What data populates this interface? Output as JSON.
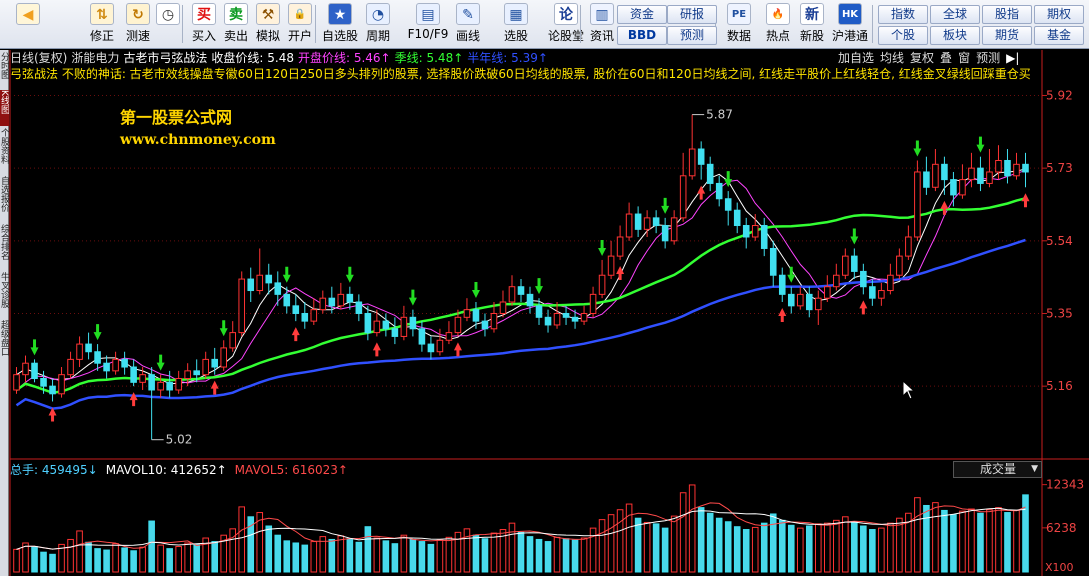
{
  "toolbar": {
    "left_buttons": [
      {
        "name": "back",
        "label": "",
        "icon": "back-arrow-icon"
      },
      {
        "name": "modify",
        "label": "修正",
        "icon": "up-down-icon"
      },
      {
        "name": "measure",
        "label": "测速",
        "icon": "refresh-icon"
      },
      {
        "name": "clock",
        "label": "",
        "icon": "clock-icon"
      },
      {
        "name": "buy",
        "label": "买入",
        "icon": "buy-icon"
      },
      {
        "name": "sell",
        "label": "卖出",
        "icon": "sell-icon"
      },
      {
        "name": "simulate",
        "label": "模拟",
        "icon": "hammer-icon"
      },
      {
        "name": "open-account",
        "label": "开户",
        "icon": "lock-icon"
      },
      {
        "name": "custom-stock",
        "label": "自选股",
        "icon": "star-icon"
      },
      {
        "name": "period",
        "label": "周期",
        "icon": "period-icon"
      },
      {
        "name": "f10",
        "label": "F10/F9",
        "icon": "f10-icon"
      },
      {
        "name": "draw",
        "label": "画线",
        "icon": "pencil-icon"
      },
      {
        "name": "select",
        "label": "选股",
        "icon": "select-icon"
      },
      {
        "name": "forum",
        "label": "论股堂",
        "icon": "forum-icon"
      },
      {
        "name": "info",
        "label": "资讯",
        "icon": "news-icon"
      },
      {
        "name": "data",
        "label": "数据",
        "icon": "pe-icon"
      },
      {
        "name": "hot",
        "label": "热点",
        "icon": "flame-icon"
      },
      {
        "name": "new-stock",
        "label": "新股",
        "icon": "newstock-icon"
      },
      {
        "name": "hk-connect",
        "label": "沪港通",
        "icon": "hk-icon"
      }
    ],
    "mid_buttons": [
      {
        "label": "资金"
      },
      {
        "label": "研报"
      },
      {
        "label": "BBD"
      },
      {
        "label": "预测"
      }
    ],
    "right_buttons": [
      {
        "label": "指数"
      },
      {
        "label": "全球"
      },
      {
        "label": "股指"
      },
      {
        "label": "期权"
      },
      {
        "label": "个股"
      },
      {
        "label": "板块"
      },
      {
        "label": "期货"
      },
      {
        "label": "基金"
      }
    ]
  },
  "sidebar": {
    "tabs": [
      {
        "label": "分时图",
        "active": false
      },
      {
        "label": "K线图",
        "active": true
      },
      {
        "label": "个股资料",
        "active": false
      },
      {
        "label": "自选报价",
        "active": false
      },
      {
        "label": "综合排名",
        "active": false
      },
      {
        "label": "牛叉诊股",
        "active": false
      },
      {
        "label": "超级盘口",
        "active": false
      }
    ]
  },
  "chart_header": {
    "items": [
      {
        "text": "日线(复权)",
        "color": "#dcdcdc"
      },
      {
        "text": "浙能电力",
        "color": "#dcdcdc"
      },
      {
        "text": "古老市弓弦战法",
        "color": "#ffffff"
      },
      {
        "text": "收盘价线: 5.48",
        "color": "#ffffff"
      },
      {
        "text": "开盘价线: 5.46↑",
        "color": "#ff44ff"
      },
      {
        "text": "季线: 5.48↑",
        "color": "#33ff33"
      },
      {
        "text": "半年线: 5.39↑",
        "color": "#3050ff"
      }
    ],
    "controls": [
      "加自选",
      "均线",
      "复权",
      "叠",
      "窗",
      "预测"
    ]
  },
  "description": "弓弦战法  不败的神话: 古老市效线操盘专徽60日120日250日多头排列的股票, 选择股价跌破60日均线的股票, 股价在60日和120日均线之间, 红线走平股价上红线轻仓, 红线金叉绿线回踩重仓买",
  "watermark": {
    "line1": "第一股票公式网",
    "line2": "www.chnmoney.com"
  },
  "chart_data": {
    "type": "candlestick",
    "price_axis_ticks": [
      5.92,
      5.73,
      5.54,
      5.35,
      5.16
    ],
    "price_range": [
      4.98,
      5.95
    ],
    "high_label": "5.87",
    "low_label": "5.02",
    "volume_axis_ticks": [
      12343,
      6238
    ],
    "volume_unit": "X100",
    "candles": [
      [
        5.15,
        5.19,
        5.14,
        5.21
      ],
      [
        5.19,
        5.22,
        5.17,
        5.24
      ],
      [
        5.22,
        5.18,
        5.17,
        5.23
      ],
      [
        5.18,
        5.16,
        5.14,
        5.2
      ],
      [
        5.16,
        5.14,
        5.12,
        5.18
      ],
      [
        5.14,
        5.19,
        5.13,
        5.21
      ],
      [
        5.19,
        5.23,
        5.18,
        5.25
      ],
      [
        5.23,
        5.27,
        5.21,
        5.29
      ],
      [
        5.27,
        5.25,
        5.23,
        5.3
      ],
      [
        5.25,
        5.22,
        5.2,
        5.27
      ],
      [
        5.22,
        5.2,
        5.18,
        5.24
      ],
      [
        5.2,
        5.23,
        5.19,
        5.25
      ],
      [
        5.23,
        5.21,
        5.19,
        5.25
      ],
      [
        5.21,
        5.17,
        5.16,
        5.23
      ],
      [
        5.17,
        5.19,
        5.15,
        5.21
      ],
      [
        5.19,
        5.15,
        5.02,
        5.21
      ],
      [
        5.15,
        5.17,
        5.13,
        5.19
      ],
      [
        5.17,
        5.15,
        5.13,
        5.2
      ],
      [
        5.15,
        5.18,
        5.14,
        5.2
      ],
      [
        5.18,
        5.2,
        5.16,
        5.22
      ],
      [
        5.2,
        5.19,
        5.17,
        5.23
      ],
      [
        5.19,
        5.23,
        5.18,
        5.25
      ],
      [
        5.23,
        5.21,
        5.19,
        5.26
      ],
      [
        5.21,
        5.26,
        5.2,
        5.28
      ],
      [
        5.26,
        5.3,
        5.25,
        5.33
      ],
      [
        5.3,
        5.44,
        5.29,
        5.46
      ],
      [
        5.44,
        5.41,
        5.38,
        5.47
      ],
      [
        5.41,
        5.45,
        5.4,
        5.52
      ],
      [
        5.45,
        5.43,
        5.4,
        5.48
      ],
      [
        5.43,
        5.4,
        5.37,
        5.46
      ],
      [
        5.4,
        5.37,
        5.35,
        5.42
      ],
      [
        5.37,
        5.35,
        5.33,
        5.4
      ],
      [
        5.35,
        5.33,
        5.31,
        5.38
      ],
      [
        5.33,
        5.36,
        5.32,
        5.39
      ],
      [
        5.36,
        5.39,
        5.35,
        5.41
      ],
      [
        5.39,
        5.37,
        5.35,
        5.42
      ],
      [
        5.37,
        5.4,
        5.36,
        5.43
      ],
      [
        5.4,
        5.38,
        5.36,
        5.42
      ],
      [
        5.38,
        5.35,
        5.33,
        5.4
      ],
      [
        5.35,
        5.3,
        5.28,
        5.37
      ],
      [
        5.3,
        5.33,
        5.29,
        5.36
      ],
      [
        5.33,
        5.31,
        5.29,
        5.35
      ],
      [
        5.31,
        5.29,
        5.27,
        5.34
      ],
      [
        5.29,
        5.34,
        5.28,
        5.37
      ],
      [
        5.34,
        5.31,
        5.29,
        5.36
      ],
      [
        5.31,
        5.27,
        5.25,
        5.33
      ],
      [
        5.27,
        5.25,
        5.23,
        5.29
      ],
      [
        5.25,
        5.28,
        5.24,
        5.31
      ],
      [
        5.28,
        5.3,
        5.27,
        5.33
      ],
      [
        5.3,
        5.34,
        5.29,
        5.36
      ],
      [
        5.34,
        5.36,
        5.33,
        5.39
      ],
      [
        5.36,
        5.33,
        5.31,
        5.38
      ],
      [
        5.33,
        5.31,
        5.29,
        5.35
      ],
      [
        5.31,
        5.35,
        5.3,
        5.38
      ],
      [
        5.35,
        5.38,
        5.34,
        5.41
      ],
      [
        5.38,
        5.42,
        5.37,
        5.45
      ],
      [
        5.42,
        5.4,
        5.38,
        5.44
      ],
      [
        5.4,
        5.37,
        5.35,
        5.42
      ],
      [
        5.37,
        5.34,
        5.32,
        5.39
      ],
      [
        5.34,
        5.32,
        5.3,
        5.36
      ],
      [
        5.32,
        5.35,
        5.31,
        5.38
      ],
      [
        5.35,
        5.34,
        5.32,
        5.37
      ],
      [
        5.34,
        5.33,
        5.31,
        5.36
      ],
      [
        5.33,
        5.35,
        5.32,
        5.37
      ],
      [
        5.35,
        5.4,
        5.34,
        5.42
      ],
      [
        5.4,
        5.45,
        5.39,
        5.49
      ],
      [
        5.45,
        5.5,
        5.44,
        5.54
      ],
      [
        5.5,
        5.55,
        5.49,
        5.58
      ],
      [
        5.55,
        5.61,
        5.54,
        5.64
      ],
      [
        5.61,
        5.57,
        5.55,
        5.63
      ],
      [
        5.57,
        5.6,
        5.55,
        5.62
      ],
      [
        5.6,
        5.58,
        5.56,
        5.62
      ],
      [
        5.58,
        5.54,
        5.52,
        5.6
      ],
      [
        5.54,
        5.6,
        5.53,
        5.62
      ],
      [
        5.6,
        5.71,
        5.59,
        5.77
      ],
      [
        5.71,
        5.78,
        5.7,
        5.87
      ],
      [
        5.78,
        5.74,
        5.7,
        5.8
      ],
      [
        5.74,
        5.69,
        5.67,
        5.76
      ],
      [
        5.69,
        5.65,
        5.63,
        5.71
      ],
      [
        5.65,
        5.62,
        5.58,
        5.67
      ],
      [
        5.62,
        5.58,
        5.56,
        5.64
      ],
      [
        5.58,
        5.55,
        5.52,
        5.6
      ],
      [
        5.55,
        5.58,
        5.54,
        5.61
      ],
      [
        5.58,
        5.52,
        5.5,
        5.6
      ],
      [
        5.52,
        5.45,
        5.42,
        5.54
      ],
      [
        5.45,
        5.4,
        5.38,
        5.47
      ],
      [
        5.4,
        5.37,
        5.35,
        5.42
      ],
      [
        5.37,
        5.4,
        5.36,
        5.42
      ],
      [
        5.4,
        5.36,
        5.34,
        5.42
      ],
      [
        5.36,
        5.39,
        5.32,
        5.41
      ],
      [
        5.39,
        5.42,
        5.38,
        5.45
      ],
      [
        5.42,
        5.45,
        5.41,
        5.48
      ],
      [
        5.45,
        5.5,
        5.44,
        5.52
      ],
      [
        5.5,
        5.46,
        5.44,
        5.52
      ],
      [
        5.46,
        5.42,
        5.4,
        5.48
      ],
      [
        5.42,
        5.39,
        5.37,
        5.44
      ],
      [
        5.39,
        5.41,
        5.37,
        5.43
      ],
      [
        5.41,
        5.45,
        5.4,
        5.48
      ],
      [
        5.45,
        5.5,
        5.44,
        5.52
      ],
      [
        5.5,
        5.55,
        5.49,
        5.58
      ],
      [
        5.55,
        5.72,
        5.54,
        5.75
      ],
      [
        5.72,
        5.68,
        5.66,
        5.76
      ],
      [
        5.68,
        5.74,
        5.67,
        5.78
      ],
      [
        5.74,
        5.7,
        5.66,
        5.76
      ],
      [
        5.7,
        5.66,
        5.63,
        5.72
      ],
      [
        5.66,
        5.7,
        5.65,
        5.74
      ],
      [
        5.7,
        5.73,
        5.68,
        5.77
      ],
      [
        5.73,
        5.69,
        5.67,
        5.76
      ],
      [
        5.69,
        5.72,
        5.68,
        5.78
      ],
      [
        5.72,
        5.75,
        5.7,
        5.79
      ],
      [
        5.75,
        5.71,
        5.69,
        5.78
      ],
      [
        5.71,
        5.74,
        5.7,
        5.77
      ],
      [
        5.74,
        5.72,
        5.68,
        5.77
      ]
    ],
    "volume": [
      3200,
      4100,
      3600,
      2800,
      2500,
      3900,
      4600,
      5800,
      4200,
      3300,
      3100,
      4000,
      3400,
      3000,
      3500,
      7200,
      3800,
      3300,
      3600,
      4100,
      3900,
      4800,
      4300,
      5200,
      6100,
      9200,
      7800,
      8400,
      6500,
      5200,
      4400,
      4100,
      3800,
      4300,
      5000,
      4600,
      5100,
      4700,
      4200,
      6400,
      4800,
      4400,
      4000,
      5200,
      4600,
      4300,
      3900,
      4500,
      4900,
      5600,
      6100,
      5200,
      4700,
      5500,
      6000,
      6900,
      5600,
      5000,
      4600,
      4300,
      4900,
      4700,
      4500,
      4800,
      6200,
      7400,
      8100,
      8800,
      9600,
      7600,
      7000,
      6800,
      6200,
      7900,
      11200,
      12300,
      9100,
      8300,
      7600,
      7100,
      6400,
      6000,
      6300,
      6900,
      8200,
      7300,
      6600,
      6200,
      6500,
      6800,
      6900,
      7300,
      7800,
      7100,
      6500,
      6000,
      6200,
      6900,
      7600,
      8300,
      10500,
      9400,
      9800,
      8700,
      8100,
      8600,
      8900,
      8300,
      8800,
      9100,
      8400,
      8700,
      10900
    ],
    "ma_lines": [
      {
        "name": "收盘价线",
        "color": "#ffffff"
      },
      {
        "name": "开盘价线",
        "color": "#ff44ff"
      },
      {
        "name": "季线",
        "color": "#33ff33"
      },
      {
        "name": "半年线",
        "color": "#3050ff"
      }
    ]
  },
  "volume_header": {
    "items": [
      {
        "text": "总手: 459495↓",
        "color": "#4fd0ff"
      },
      {
        "text": "MAVOL10: 412652↑",
        "color": "#ffffff"
      },
      {
        "text": "MAVOL5: 616023↑",
        "color": "#ff4a4a"
      }
    ],
    "selector": "成交量"
  },
  "colors": {
    "up": "#ff3333",
    "down": "#40e0f0",
    "axis": "#c81e1e",
    "grid": "#6a0e0e"
  }
}
